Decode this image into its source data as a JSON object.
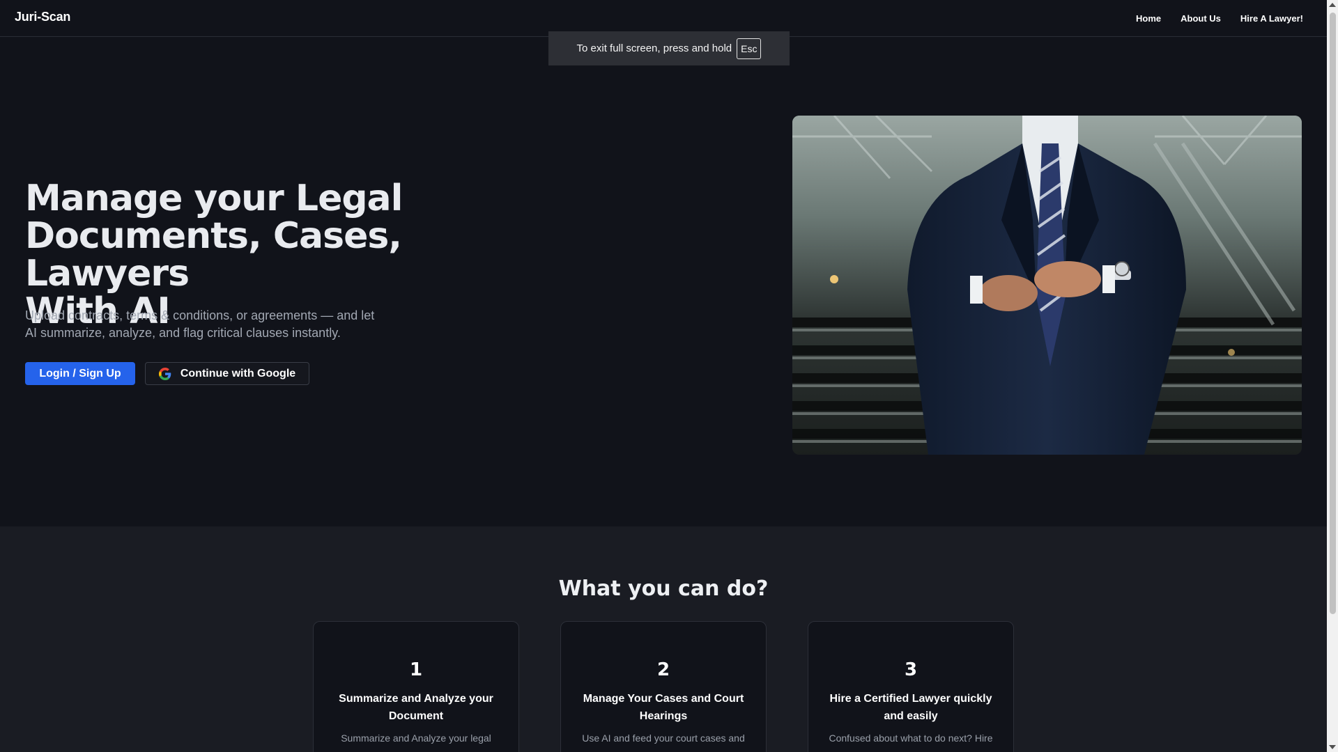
{
  "nav": {
    "brand": "Juri-Scan",
    "links": [
      "Home",
      "About Us",
      "Hire A Lawyer!"
    ]
  },
  "fullscreen_notice": {
    "text": "To exit full screen, press and hold",
    "key": "Esc"
  },
  "hero": {
    "title_lines": [
      "Manage your Legal",
      "Documents, Cases, Lawyers",
      "With AI"
    ],
    "subtitle": "Upload contracts, terms & conditions, or agreements — and let AI summarize, analyze, and flag critical clauses instantly.",
    "primary_button": "Login / Sign Up",
    "google_button": "Continue with Google",
    "image_icon": "businessman-in-suit-photo"
  },
  "features": {
    "title": "What you can do?",
    "cards": [
      {
        "number": "1",
        "title": "Summarize and Analyze your Document",
        "text": "Summarize and Analyze your legal"
      },
      {
        "number": "2",
        "title": "Manage Your Cases and Court Hearings",
        "text": "Use AI and feed your court cases and"
      },
      {
        "number": "3",
        "title": "Hire a Certified Lawyer quickly and easily",
        "text": "Confused about what to do next? Hire"
      }
    ]
  },
  "colors": {
    "background": "#11131a",
    "section_background": "#1a1c23",
    "primary": "#2563eb"
  }
}
